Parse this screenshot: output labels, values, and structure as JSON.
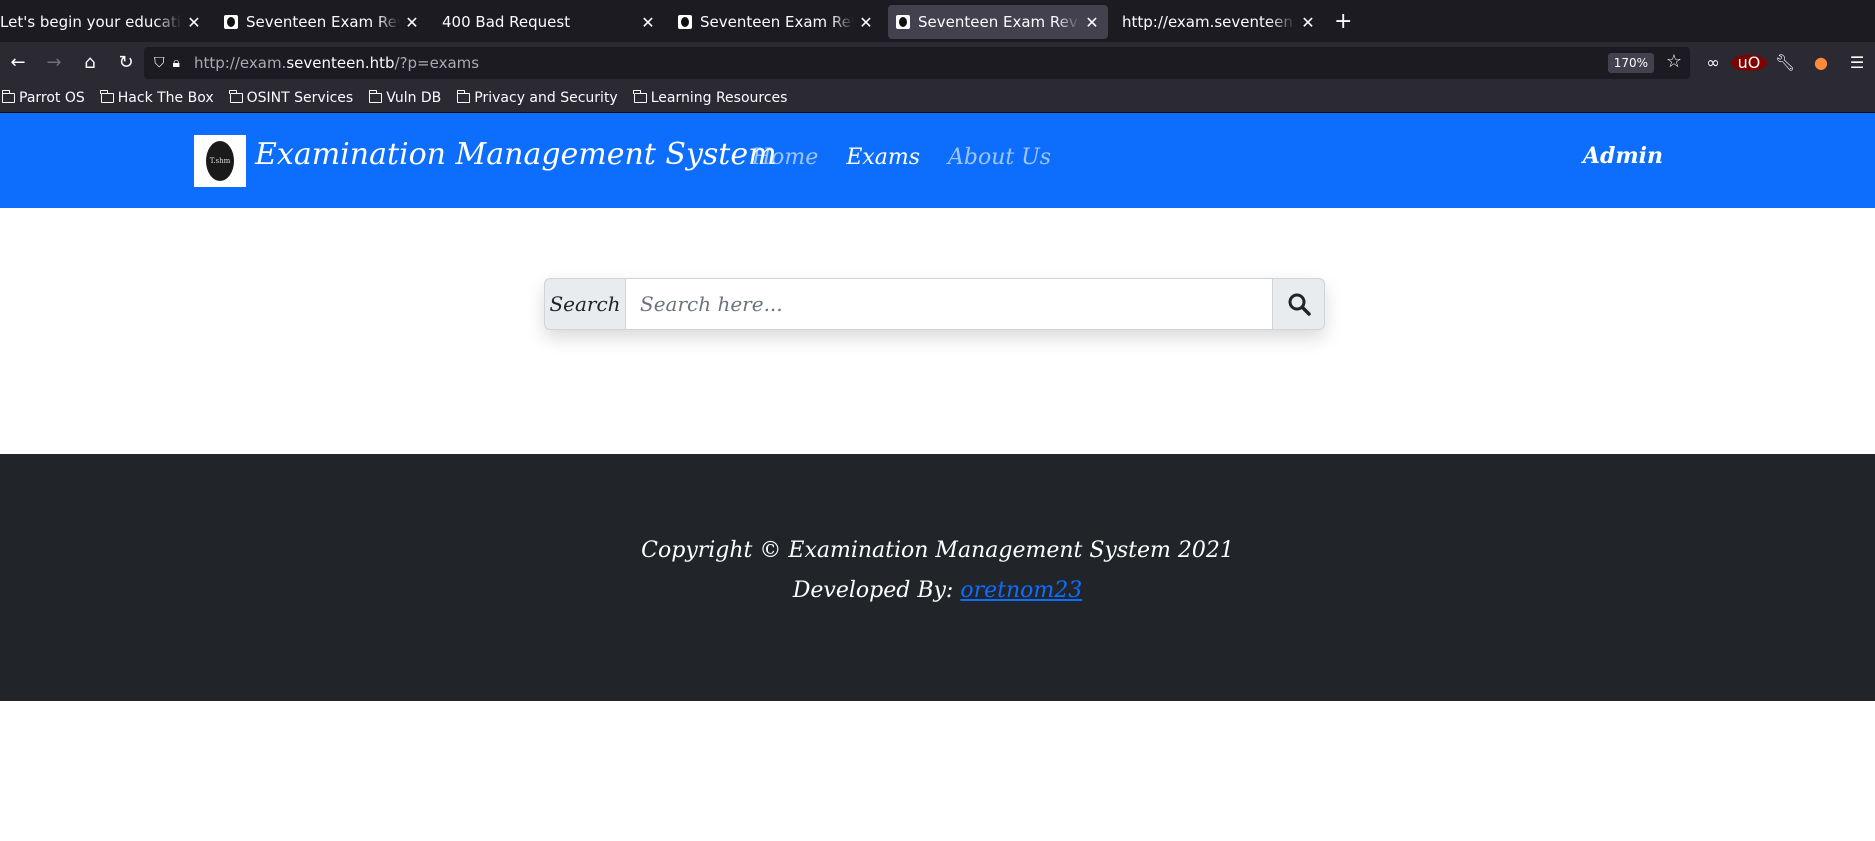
{
  "browser": {
    "tabs": [
      {
        "title": "Let's begin your education w",
        "favicon": false,
        "active": false
      },
      {
        "title": "Seventeen Exam Reviewer",
        "favicon": true,
        "active": false
      },
      {
        "title": "400 Bad Request",
        "favicon": false,
        "active": false
      },
      {
        "title": "Seventeen Exam Reviewer",
        "favicon": true,
        "active": false
      },
      {
        "title": "Seventeen Exam Reviewer",
        "favicon": true,
        "active": true
      },
      {
        "title": "http://exam.seventeen.htb/?",
        "favicon": false,
        "active": false
      }
    ],
    "url_prefix": "http://exam.",
    "url_host": "seventeen.htb",
    "url_suffix": "/?p=exams",
    "zoom": "170%",
    "bookmarks": [
      "Parrot OS",
      "Hack The Box",
      "OSINT Services",
      "Vuln DB",
      "Privacy and Security",
      "Learning Resources"
    ]
  },
  "site": {
    "brand": "Examination Management System",
    "logo_text": "T.shm",
    "nav": [
      {
        "label": "Home",
        "active": false
      },
      {
        "label": "Exams",
        "active": true
      },
      {
        "label": "About Us",
        "active": false
      }
    ],
    "admin": "Admin",
    "search": {
      "label": "Search",
      "placeholder": "Search here..."
    },
    "footer": {
      "copyright": "Copyright © Examination Management System 2021",
      "dev_prefix": "Developed By: ",
      "dev_name": "oretnom23"
    }
  },
  "colors": {
    "primary": "#0d6efd",
    "footer_bg": "#212529"
  }
}
